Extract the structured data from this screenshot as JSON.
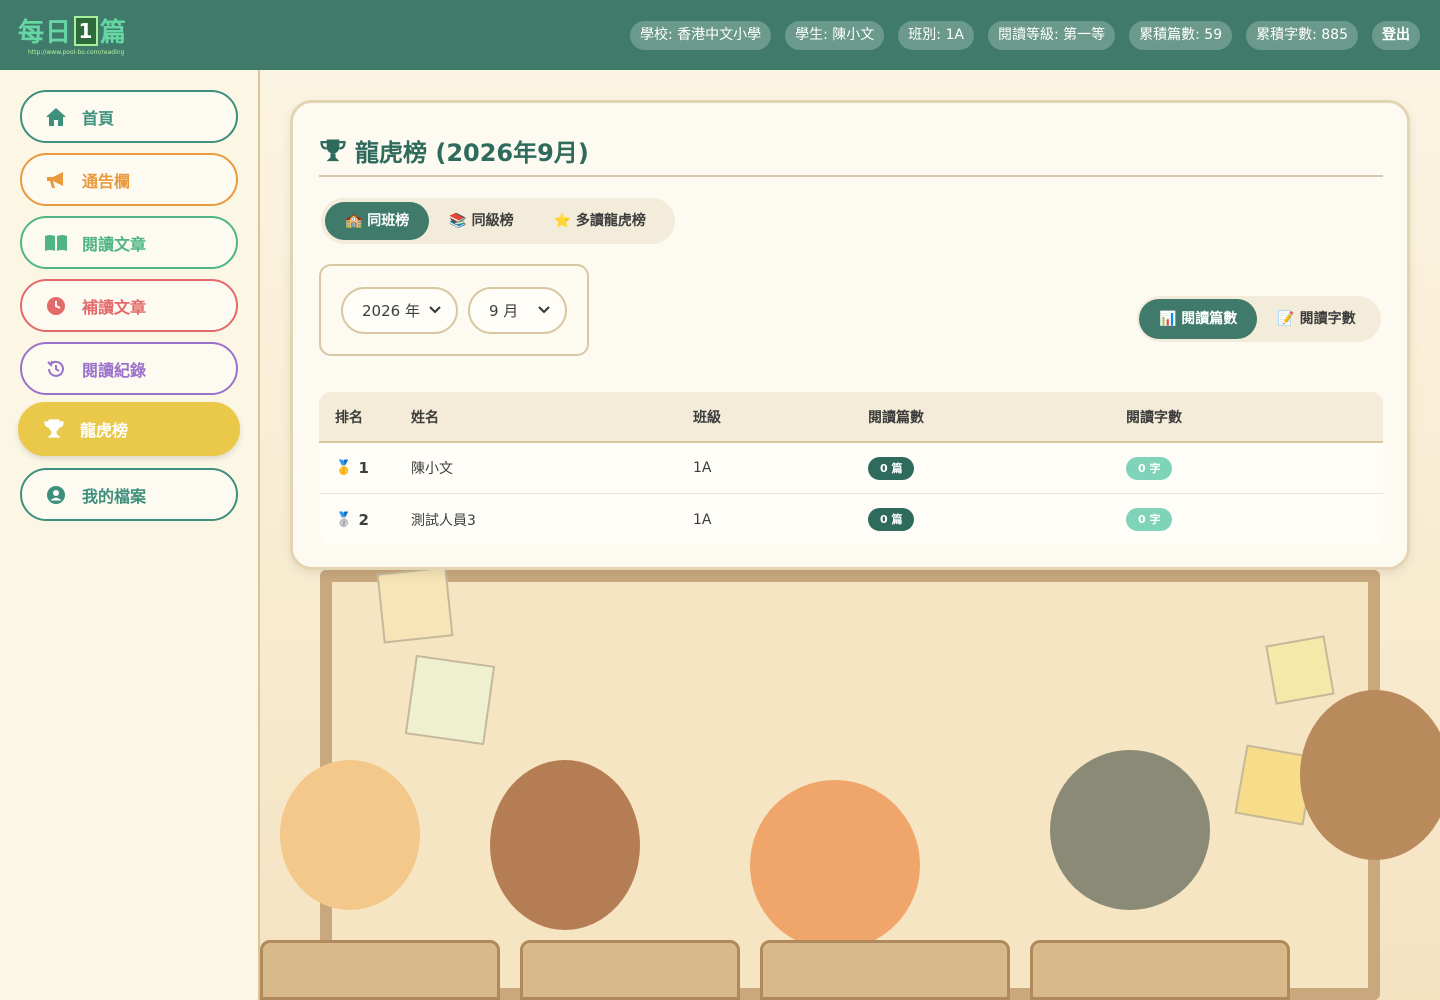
{
  "logo": {
    "text_a": "每日",
    "text_box": "1",
    "text_b": "篇",
    "url": "http://www.pool-bo.com/reading"
  },
  "header": {
    "school": "學校: 香港中文小學",
    "student": "學生: 陳小文",
    "class": "班別: 1A",
    "level": "閱讀等級: 第一等",
    "total_articles": "累積篇數: 59",
    "total_words": "累積字數: 885",
    "logout": "登出"
  },
  "sidebar": {
    "items": [
      {
        "label": "首頁",
        "icon": "home-icon",
        "color": "#3f8f7d"
      },
      {
        "label": "通告欄",
        "icon": "megaphone-icon",
        "color": "#e89a3c"
      },
      {
        "label": "閱讀文章",
        "icon": "book-icon",
        "color": "#4fb583"
      },
      {
        "label": "補讀文章",
        "icon": "clock-icon",
        "color": "#e36a6a"
      },
      {
        "label": "閱讀紀錄",
        "icon": "history-icon",
        "color": "#9a72c9"
      },
      {
        "label": "龍虎榜",
        "icon": "trophy-icon",
        "color": "#e9c84a"
      },
      {
        "label": "我的檔案",
        "icon": "user-circle-icon",
        "color": "#3f8f7d"
      }
    ]
  },
  "main": {
    "title": "龍虎榜 (2026年9月)",
    "tabs": [
      {
        "label": "🏫 同班榜"
      },
      {
        "label": "📚 同級榜"
      },
      {
        "label": "⭐ 多讀龍虎榜"
      }
    ],
    "year_select": "2026 年",
    "month_select": "9 月",
    "toggle": [
      {
        "label": "📊 閱讀篇數"
      },
      {
        "label": "📝 閱讀字數"
      }
    ],
    "table": {
      "headers": [
        "排名",
        "姓名",
        "班級",
        "閱讀篇數",
        "閱讀字數"
      ],
      "rows": [
        {
          "medal": "🥇",
          "rank": "1",
          "name": "陳小文",
          "class": "1A",
          "articles": "0 篇",
          "words": "0 字"
        },
        {
          "medal": "🥈",
          "rank": "2",
          "name": "測試人員3",
          "class": "1A",
          "articles": "0 篇",
          "words": "0 字"
        }
      ]
    }
  },
  "colors": {
    "header_bg": "#3f7a6a",
    "accent": "#2f6b5c",
    "active_nav": "#e9c84a",
    "page_bg": "#fbf6e6"
  }
}
